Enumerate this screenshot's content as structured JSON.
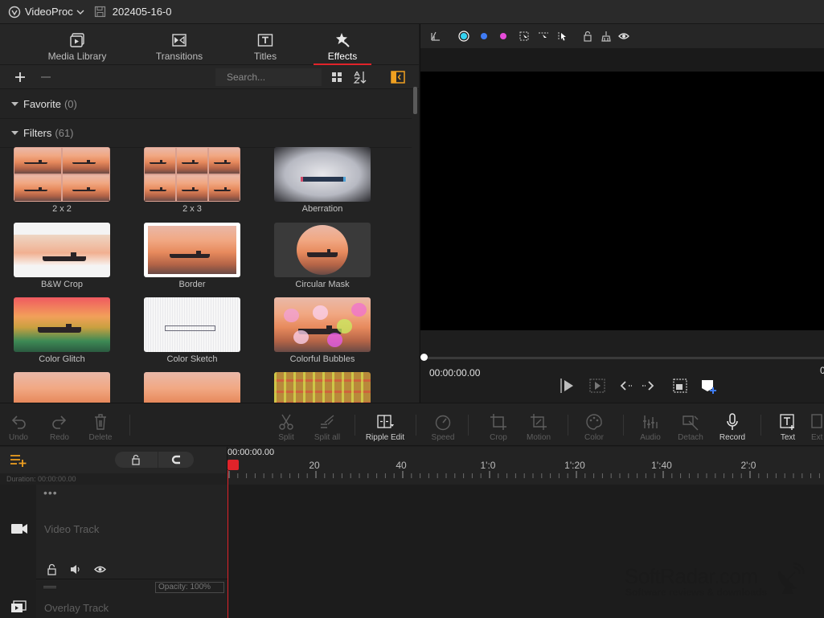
{
  "titlebar": {
    "app_name": "VideoProc",
    "project_name": "202405-16-0"
  },
  "tabs": [
    {
      "label": "Media Library",
      "icon": "media-library-icon"
    },
    {
      "label": "Transitions",
      "icon": "transitions-icon"
    },
    {
      "label": "Titles",
      "icon": "titles-icon"
    },
    {
      "label": "Effects",
      "icon": "effects-icon",
      "active": true
    }
  ],
  "library": {
    "search_placeholder": "Search..."
  },
  "sections": {
    "favorite": {
      "name": "Favorite",
      "count": "(0)"
    },
    "filters": {
      "name": "Filters",
      "count": "(61)"
    }
  },
  "filters": [
    {
      "name": "2 x 2",
      "style": "grid2x2"
    },
    {
      "name": "2 x 3",
      "style": "grid2x3"
    },
    {
      "name": "Aberration",
      "style": "aberration"
    },
    {
      "name": "B&W Crop",
      "style": "bwcrop"
    },
    {
      "name": "Border",
      "style": "border"
    },
    {
      "name": "Circular Mask",
      "style": "circle"
    },
    {
      "name": "Color Glitch",
      "style": "glitch"
    },
    {
      "name": "Color Sketch",
      "style": "sketch"
    },
    {
      "name": "Colorful Bubbles",
      "style": "bubbles"
    },
    {
      "name": "",
      "style": "plain"
    },
    {
      "name": "",
      "style": "plain"
    },
    {
      "name": "",
      "style": "mosaic"
    }
  ],
  "preview": {
    "current_time": "00:00:00.00",
    "right_time_fragment": "0",
    "accent_colors": {
      "cyan": "#35d3f2",
      "blue": "#3f7cf5",
      "magenta": "#e64bd9"
    }
  },
  "edit_tools": [
    {
      "label": "Undo",
      "icon": "undo-icon",
      "enabled": false
    },
    {
      "label": "Redo",
      "icon": "redo-icon",
      "enabled": false
    },
    {
      "label": "Delete",
      "icon": "delete-icon",
      "enabled": false
    },
    {
      "label": "Split",
      "icon": "scissors-icon",
      "enabled": false
    },
    {
      "label": "Split all",
      "icon": "split-all-icon",
      "enabled": false
    },
    {
      "label": "Ripple Edit",
      "icon": "ripple-edit-icon",
      "enabled": true
    },
    {
      "label": "Speed",
      "icon": "speed-icon",
      "enabled": false
    },
    {
      "label": "Crop",
      "icon": "crop-icon",
      "enabled": false
    },
    {
      "label": "Motion",
      "icon": "motion-icon",
      "enabled": false
    },
    {
      "label": "Color",
      "icon": "palette-icon",
      "enabled": false
    },
    {
      "label": "Audio",
      "icon": "audio-icon",
      "enabled": false
    },
    {
      "label": "Detach",
      "icon": "detach-icon",
      "enabled": false
    },
    {
      "label": "Record",
      "icon": "microphone-icon",
      "enabled": true
    },
    {
      "label": "Text",
      "icon": "text-icon",
      "enabled": true
    },
    {
      "label": "Ext",
      "icon": "export-icon",
      "enabled": false
    }
  ],
  "timeline": {
    "current_time": "00:00:00.00",
    "duration": "Duration: 00:00:00.00",
    "ruler_labels": [
      "20",
      "40",
      "1':0",
      "1':20",
      "1':40",
      "2':0"
    ],
    "video_track": "Video Track",
    "overlay_track": "Overlay Track",
    "opacity": "Opacity: 100%",
    "dots": "•••"
  },
  "watermark": {
    "title": "SoftRadar.com",
    "subtitle": "Software reviews & downloads"
  },
  "colors": {
    "accent_red": "#e0232a",
    "accent_orange": "#f0a020"
  }
}
